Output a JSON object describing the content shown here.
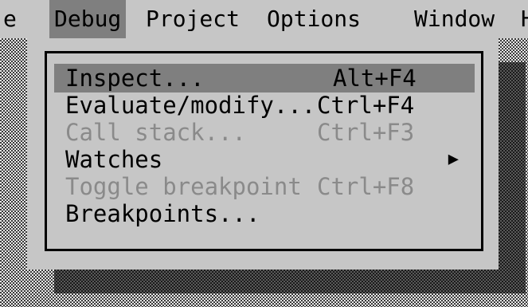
{
  "menubar": {
    "items": [
      {
        "label": "e"
      },
      {
        "label": "Debug",
        "active": true
      },
      {
        "label": "Project"
      },
      {
        "label": "Options"
      },
      {
        "label": "Window"
      },
      {
        "label": "H"
      }
    ]
  },
  "debug_menu": {
    "items": [
      {
        "label": "Inspect...",
        "shortcut": "Alt+F4",
        "selected": true,
        "enabled": true
      },
      {
        "label": "Evaluate/modify...",
        "shortcut": "Ctrl+F4",
        "enabled": true
      },
      {
        "label": "Call stack...",
        "shortcut": "Ctrl+F3",
        "enabled": false
      },
      {
        "label": "Watches",
        "shortcut": "",
        "submenu_arrow": "▶",
        "enabled": true
      },
      {
        "label": "Toggle breakpoint",
        "shortcut": "Ctrl+F8",
        "enabled": false
      },
      {
        "label": "Breakpoints...",
        "shortcut": "",
        "enabled": true
      }
    ]
  },
  "colors": {
    "menu_bg": "#c6c6c6",
    "highlight": "#7f7f7f",
    "disabled_text": "#8a8a8a",
    "text": "#000000"
  }
}
